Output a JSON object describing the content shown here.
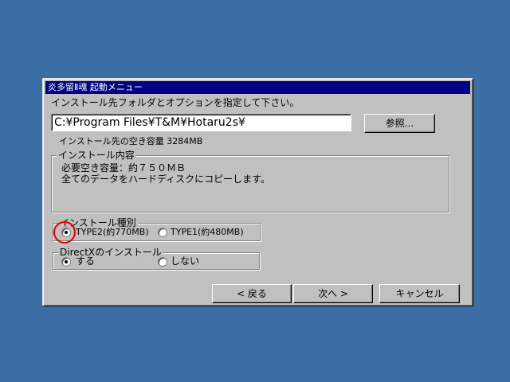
{
  "window": {
    "title": "炎多留Ⅱ魂 起動メニュー"
  },
  "instruction": "インストール先フォルダとオプションを指定して下さい。",
  "path_input": {
    "value": "C:¥Program Files¥T&M¥Hotaru2s¥"
  },
  "browse_button": "参照...",
  "free_space": "インストール先の空き容量 3284MB",
  "contents_group": {
    "legend": "インストール内容",
    "lines": [
      "必要空き容量：約７５０ＭＢ",
      "全てのデータをハードディスクにコピーします。"
    ]
  },
  "type_group": {
    "legend": "インストール種別",
    "options": [
      {
        "label": "TYPE2(約770MB)",
        "selected": true
      },
      {
        "label": "TYPE1(約480MB)",
        "selected": false
      }
    ]
  },
  "directx_group": {
    "legend": "DirectXのインストール",
    "options": [
      {
        "label": "する",
        "selected": true
      },
      {
        "label": "しない",
        "selected": false
      }
    ]
  },
  "buttons": {
    "back": "< 戻る",
    "next": "次へ >",
    "cancel": "キャンセル"
  },
  "colors": {
    "desktop": "#3a6ea5",
    "titlebar": "#000080",
    "dialog": "#c0c0c0",
    "highlight_circle": "#e00000"
  }
}
